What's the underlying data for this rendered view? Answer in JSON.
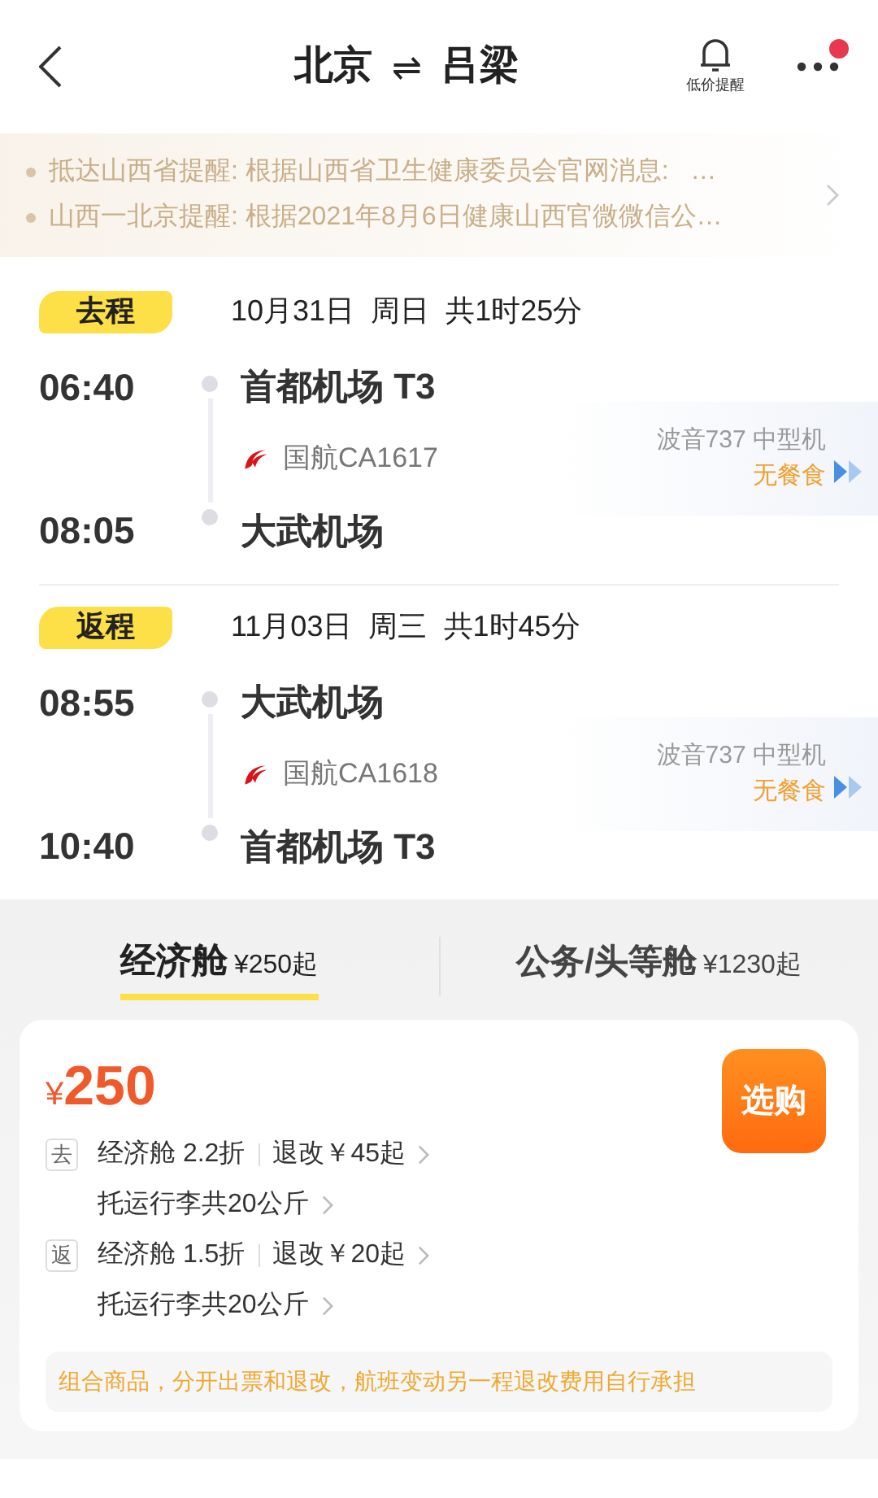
{
  "header": {
    "from": "北京",
    "swap": "⇌",
    "to": "吕梁",
    "alert_label": "低价提醒",
    "more_badge": true
  },
  "notices": [
    "抵达山西省提醒: 根据山西省卫生健康委员会官网消息:   …",
    "山西一北京提醒: 根据2021年8月6日健康山西官微微信公…"
  ],
  "legs": [
    {
      "tag": "去程",
      "date": "10月31日",
      "weekday": "周日",
      "duration": "共1时25分",
      "depart_time": "06:40",
      "depart_airport": "首都机场 T3",
      "airline": "国航CA1617",
      "aircraft": "波音737 中型机",
      "meal": "无餐食",
      "arrive_time": "08:05",
      "arrive_airport": "大武机场"
    },
    {
      "tag": "返程",
      "date": "11月03日",
      "weekday": "周三",
      "duration": "共1时45分",
      "depart_time": "08:55",
      "depart_airport": "大武机场",
      "airline": "国航CA1618",
      "aircraft": "波音737 中型机",
      "meal": "无餐食",
      "arrive_time": "10:40",
      "arrive_airport": "首都机场 T3"
    }
  ],
  "cabin_tabs": [
    {
      "label": "经济舱",
      "price": "¥250起",
      "selected": true
    },
    {
      "label": "公务/头等舱",
      "price": "¥1230起",
      "selected": false
    }
  ],
  "offer": {
    "currency": "¥",
    "price": "250",
    "buy_button": "选购",
    "segments": [
      {
        "tag": "去",
        "fare": "经济舱 2.2折",
        "refund": "退改￥45起",
        "baggage": "托运行李共20公斤"
      },
      {
        "tag": "返",
        "fare": "经济舱 1.5折",
        "refund": "退改￥20起",
        "baggage": "托运行李共20公斤"
      }
    ],
    "note": "组合商品，分开出票和退改，航班变动另一程退改费用自行承担"
  }
}
